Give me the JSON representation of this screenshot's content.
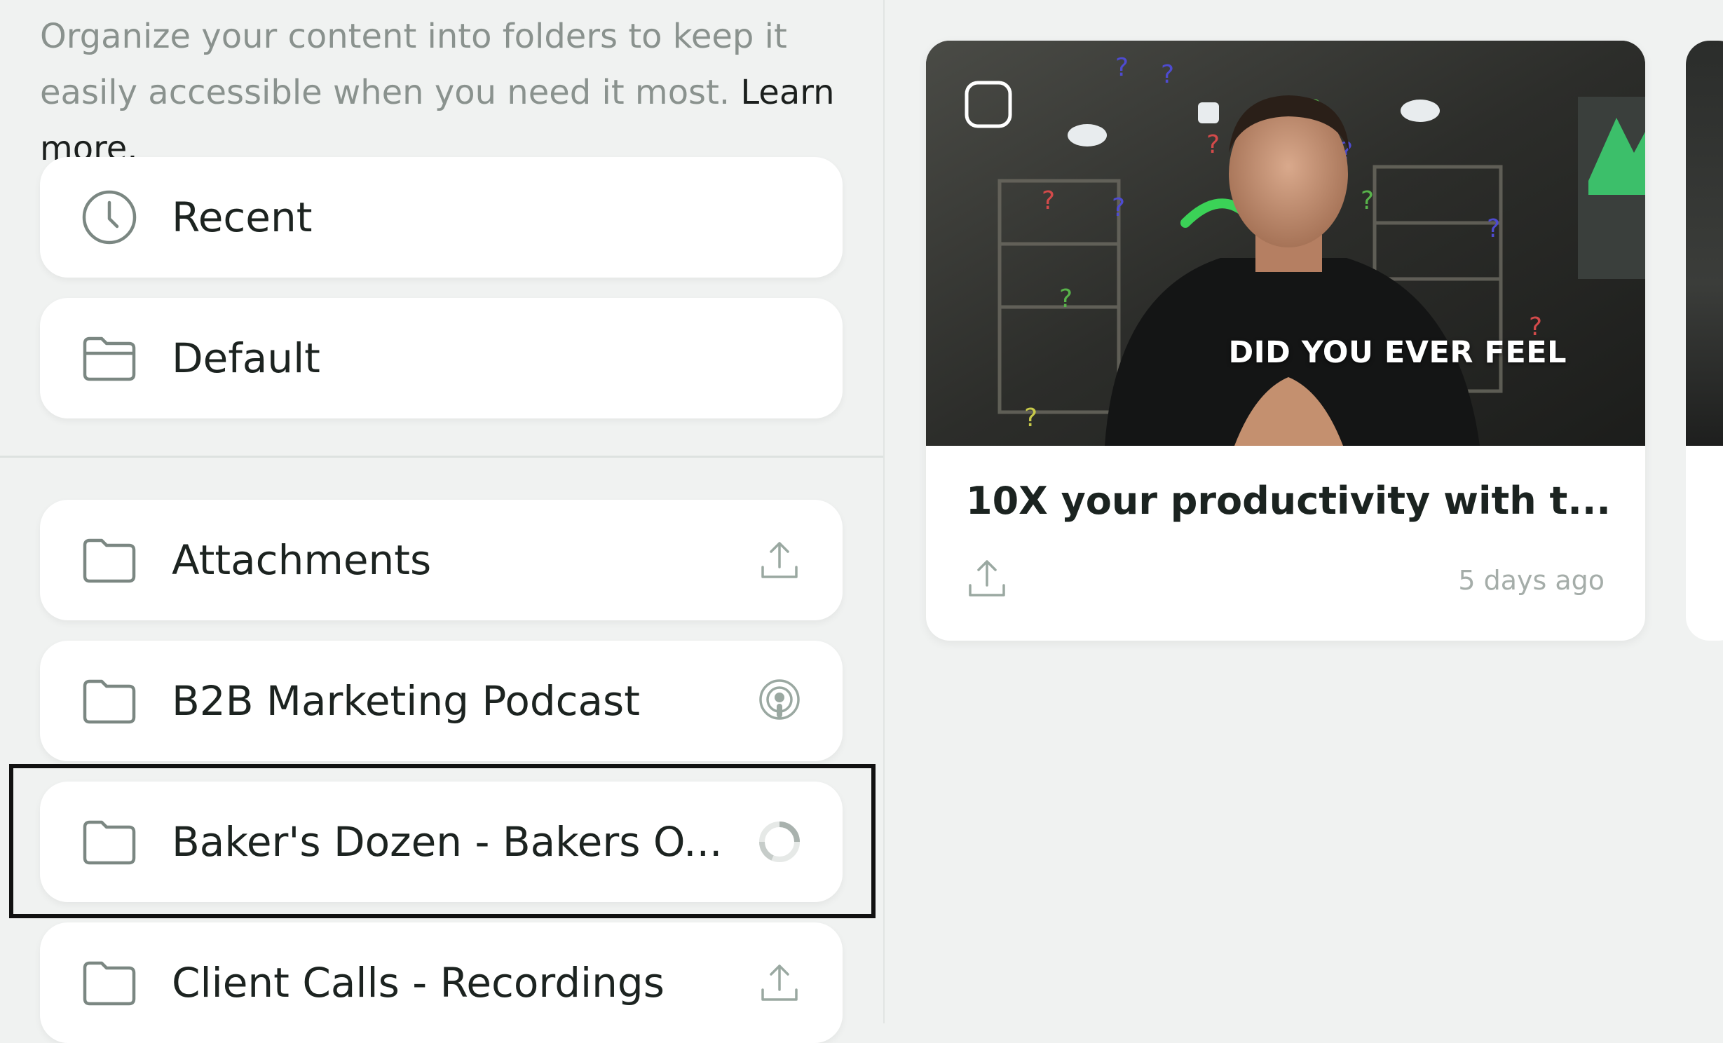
{
  "intro": {
    "text": "Organize your content into folders to keep it easily accessible when you need it most.",
    "link": "Learn more."
  },
  "quick": [
    {
      "label": "Recent",
      "icon": "clock-icon"
    },
    {
      "label": "Default",
      "icon": "folder-open-icon"
    }
  ],
  "folders": [
    {
      "label": "Attachments",
      "status_icon": "upload-icon"
    },
    {
      "label": "B2B Marketing Podcast",
      "status_icon": "podcast-icon"
    },
    {
      "label": "Baker's Dozen - Bakers O...",
      "status_icon": "loading-spinner-icon"
    },
    {
      "label": "Client Calls - Recordings",
      "status_icon": "upload-icon"
    }
  ],
  "card": {
    "caption": "DID YOU EVER FEEL",
    "title": "10X your productivity with t...",
    "date": "5 days ago"
  },
  "colors": {
    "accent_green": "#3bbf52",
    "icon_gray": "#7b8782",
    "background": "#f0f2f1"
  }
}
